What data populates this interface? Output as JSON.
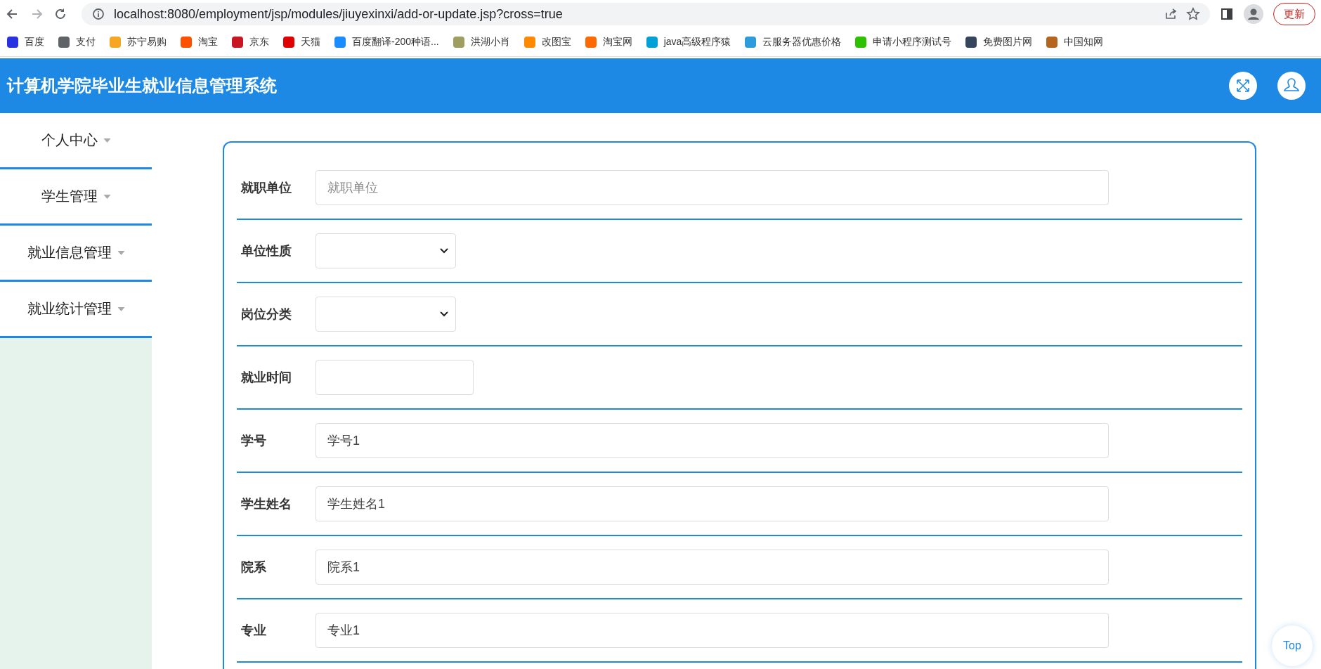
{
  "browser": {
    "url": "localhost:8080/employment/jsp/modules/jiuyexinxi/add-or-update.jsp?cross=true",
    "update_button": "更新",
    "bookmarks": [
      {
        "label": "百度",
        "color": "#2932e1"
      },
      {
        "label": "支付",
        "color": "#5f6368"
      },
      {
        "label": "苏宁易购",
        "color": "#f5a623"
      },
      {
        "label": "淘宝",
        "color": "#ff5000"
      },
      {
        "label": "京东",
        "color": "#c91623"
      },
      {
        "label": "天猫",
        "color": "#e00000"
      },
      {
        "label": "百度翻译-200种语...",
        "color": "#1a8cff"
      },
      {
        "label": "洪湖小肖",
        "color": "#9e9e60"
      },
      {
        "label": "改图宝",
        "color": "#ff8a00"
      },
      {
        "label": "淘宝网",
        "color": "#ff6a00"
      },
      {
        "label": "java高级程序猿",
        "color": "#00a1d6"
      },
      {
        "label": "云服务器优惠价格",
        "color": "#2d9cdb"
      },
      {
        "label": "申请小程序测试号",
        "color": "#2dc100"
      },
      {
        "label": "免费图片网",
        "color": "#35465c"
      },
      {
        "label": "中国知网",
        "color": "#b5651d"
      }
    ]
  },
  "header": {
    "title": "计算机学院毕业生就业信息管理系统"
  },
  "sidebar": {
    "items": [
      {
        "label": "个人中心"
      },
      {
        "label": "学生管理"
      },
      {
        "label": "就业信息管理"
      },
      {
        "label": "就业统计管理"
      }
    ]
  },
  "form": {
    "fields": [
      {
        "label": "就职单位",
        "kind": "text",
        "placeholder": "就职单位"
      },
      {
        "label": "单位性质",
        "kind": "select"
      },
      {
        "label": "岗位分类",
        "kind": "select"
      },
      {
        "label": "就业时间",
        "kind": "date"
      },
      {
        "label": "学号",
        "kind": "text",
        "value": "学号1"
      },
      {
        "label": "学生姓名",
        "kind": "text",
        "value": "学生姓名1"
      },
      {
        "label": "院系",
        "kind": "text",
        "value": "院系1"
      },
      {
        "label": "专业",
        "kind": "text",
        "value": "专业1"
      }
    ]
  },
  "top_button": "Top"
}
